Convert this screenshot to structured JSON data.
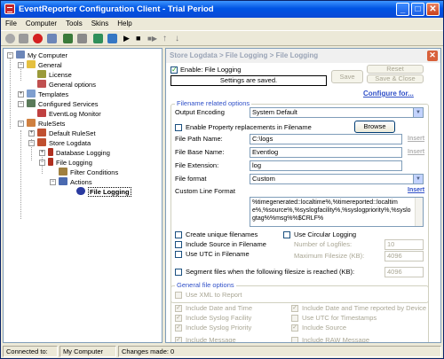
{
  "window": {
    "title": "EventReporter Configuration Client - Trial Period",
    "min_glyph": "_",
    "max_glyph": "□",
    "close_glyph": "✕"
  },
  "menu": [
    "File",
    "Computer",
    "Tools",
    "Skins",
    "Help"
  ],
  "toolbar_icons": [
    "disabled-check-icon",
    "save-icon",
    "stop-icon",
    "connect-icon",
    "computer-icon",
    "grid-icon",
    "doc-icon",
    "doc2-icon",
    "play-icon",
    "stop-square-icon",
    "play-stop-icon",
    "up-arrow-icon",
    "down-arrow-icon"
  ],
  "tree": {
    "my_computer": "My Computer",
    "general": "General",
    "license": "License",
    "general_options": "General options",
    "templates": "Templates",
    "configured_services": "Configured Services",
    "eventlog_monitor": "EventLog Monitor",
    "rulesets": "RuleSets",
    "default_ruleset": "Default RuleSet",
    "store_logdata": "Store Logdata",
    "database_logging": "Database Logging",
    "file_logging": "File Logging",
    "filter_conditions": "Filter Conditions",
    "actions": "Actions",
    "file_logging_action": "File Logging"
  },
  "panel": {
    "breadcrumb": "Store Logdata > File Logging > File Logging",
    "close_glyph": "✕",
    "enable_label": "Enable: File Logging",
    "enable_checked": true,
    "saved_status": "Settings are saved.",
    "save_label": "Save",
    "reset_label": "Reset",
    "save_close_label": "Save & Close",
    "configure_for": "Configure for...",
    "filename_group": "Filename related options",
    "output_encoding_label": "Output Encoding",
    "output_encoding_value": "System Default",
    "enable_property_label": "Enable Property replacements in Filename",
    "browse_label": "Browse",
    "file_path_label": "File Path Name:",
    "file_path_value": "C:\\logs",
    "insert1": "Insert",
    "file_base_label": "File Base Name:",
    "file_base_value": "Eventlog",
    "insert2": "Insert",
    "file_ext_label": "File Extension:",
    "file_ext_value": "log",
    "file_format_label": "File format",
    "file_format_value": "Custom",
    "custom_line_label": "Custom Line Format",
    "insert3": "Insert",
    "custom_line_value": "%timegenerated::localtime%,%timereported::localtime%,%source%,%syslogfacility%,%syslogpriority%,%syslogtag%%msg%%$CRLF%",
    "create_unique_label": "Create unique filenames",
    "use_circular_label": "Use Circular Logging",
    "include_source_label": "Include Source in Filename",
    "number_logfiles_label": "Number of Logfiles:",
    "number_logfiles_value": "10",
    "use_utc_label": "Use UTC in Filename",
    "max_filesize_label": "Maximum Filesize (KB):",
    "max_filesize_value": "4096",
    "segment_label": "Segment files when the following filesize is reached (KB):",
    "segment_value": "4096",
    "general_group": "General file options",
    "use_xml_label": "Use XML to Report",
    "include_date_label": "Include Date and Time",
    "include_reported_label": "Include Date and Time reported by Device",
    "include_facility_label": "Include Syslog Facility",
    "use_utc_ts_label": "Use UTC for Timestamps",
    "include_priority_label": "Include Syslog Priority",
    "include_source2_label": "Include Source",
    "include_message_label": "Include Message",
    "include_raw_label": "Include RAW Message"
  },
  "status": {
    "connected_label": "Connected to:",
    "connected_value": "My Computer",
    "changes_label": "Changes made: 0"
  },
  "colors": {
    "title_blue": "#0054E3",
    "link_blue": "#3050C8",
    "panel_bg": "#FFFFFF",
    "chrome_bg": "#ECE9D8"
  }
}
